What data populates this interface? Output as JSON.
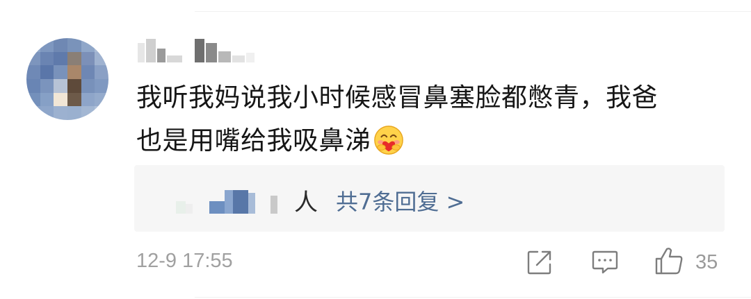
{
  "comment": {
    "line1": "我听我妈说我小时候感冒鼻塞脸都憋青，我爸",
    "line2": "也是用嘴给我吸鼻涕",
    "emoji": "hugging-heart-emoji"
  },
  "replies": {
    "person_suffix": "人",
    "summary_link": "共7条回复 >"
  },
  "footer": {
    "timestamp": "12-9 17:55",
    "like_count": "35"
  },
  "colors": {
    "link": "#4f6d93",
    "muted": "#a0a0a0",
    "reply_bg": "#f6f6f6"
  }
}
